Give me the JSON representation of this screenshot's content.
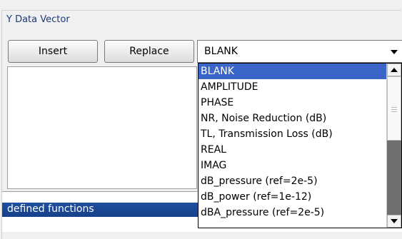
{
  "group": {
    "title": "Y Data Vector"
  },
  "buttons": {
    "insert_label": "Insert",
    "replace_label": "Replace"
  },
  "combo": {
    "value": "BLANK"
  },
  "lower_list": {
    "selected_label": "defined functions"
  },
  "dropdown": {
    "items": [
      "BLANK",
      "AMPLITUDE",
      "PHASE",
      "NR, Noise Reduction (dB)",
      "TL, Transmission Loss (dB)",
      "REAL",
      "IMAG",
      "dB_pressure (ref=2e-5)",
      "dB_power (ref=1e-12)",
      "dBA_pressure (ref=2e-5)"
    ],
    "selected_index": 0
  },
  "colors": {
    "selection": "#3a66c8",
    "list_selection": "#16408a"
  }
}
